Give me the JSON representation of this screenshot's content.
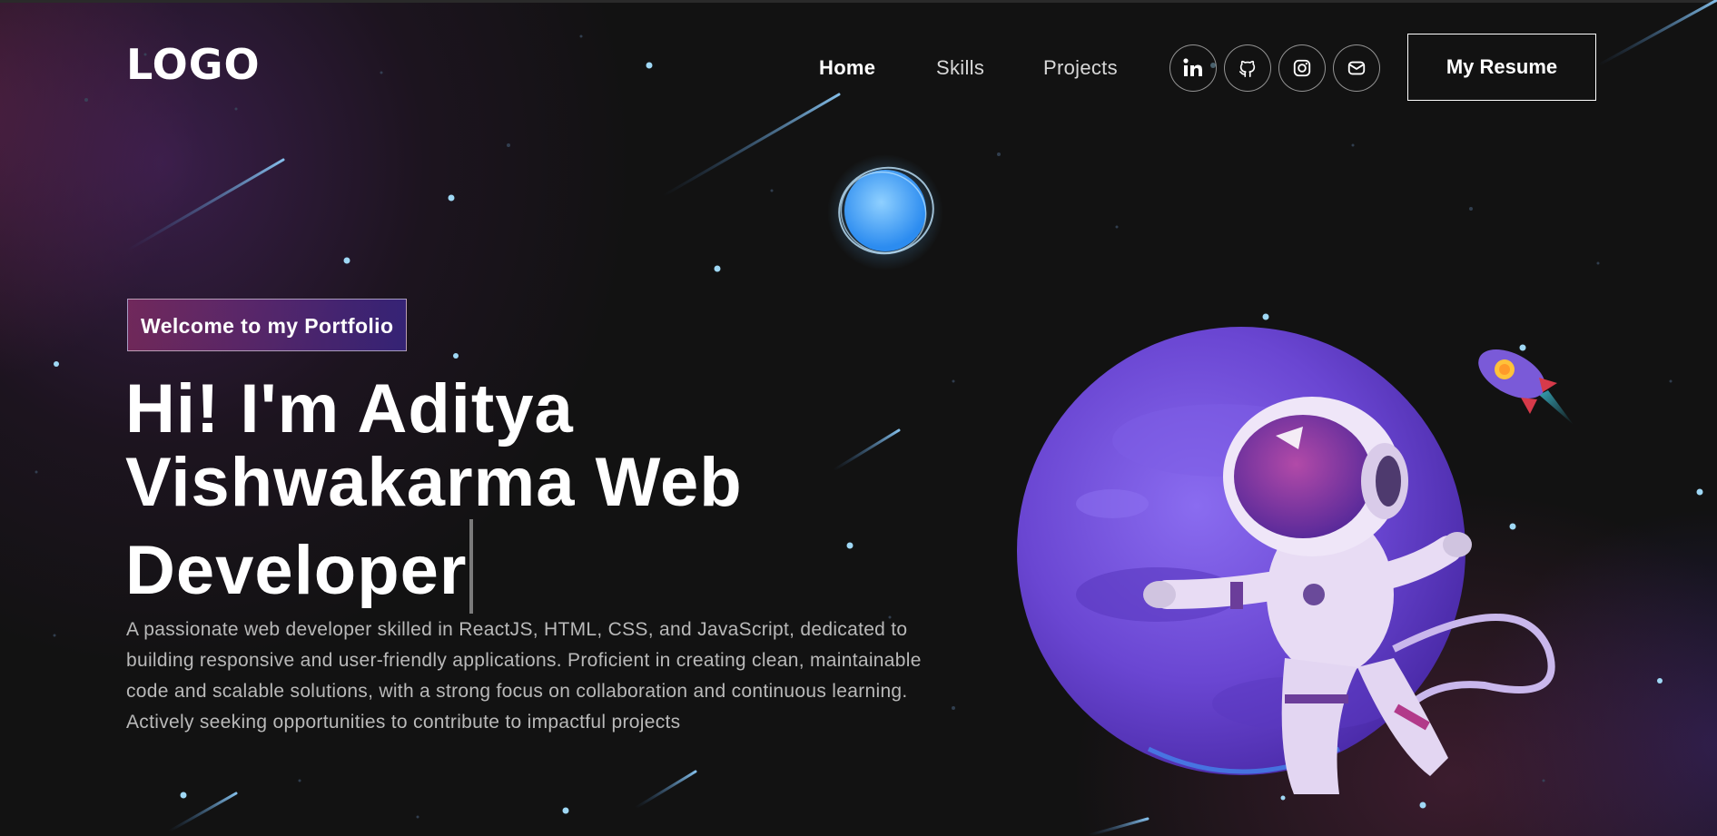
{
  "navbar": {
    "logo": "LOGO",
    "links": [
      {
        "label": "Home",
        "active": true
      },
      {
        "label": "Skills",
        "active": false
      },
      {
        "label": "Projects",
        "active": false
      }
    ],
    "social_icons": [
      "linkedin-icon",
      "github-icon",
      "instagram-icon",
      "mail-icon"
    ],
    "resume_label": "My Resume"
  },
  "hero": {
    "tagline": "Welcome to my Portfolio",
    "headline_line1": "Hi! I'm Aditya",
    "headline_line2": "Vishwakarma Web",
    "headline_line3": "Developer",
    "description": "A passionate web developer skilled in ReactJS, HTML, CSS, and JavaScript, dedicated to building responsive and user-friendly applications. Proficient in creating clean, maintainable code and scalable solutions, with a strong focus on collaboration and continuous learning. Actively seeking opportunities to contribute to impactful projects"
  },
  "colors": {
    "background": "#121212",
    "tagline_gradient_start": "#AA367C",
    "tagline_gradient_end": "#4A2FBD",
    "planet": "#6E4FD6",
    "star": "#9FD8F5"
  }
}
